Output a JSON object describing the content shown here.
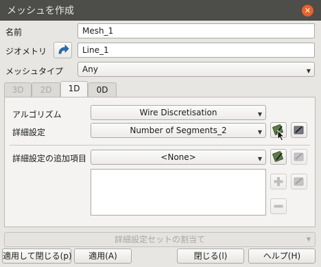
{
  "window": {
    "title": "メッシュを作成"
  },
  "form": {
    "name_label": "名前",
    "name_value": "Mesh_1",
    "geometry_label": "ジオメトリ",
    "geometry_value": "Line_1",
    "mesh_type_label": "メッシュタイプ",
    "mesh_type_value": "Any"
  },
  "tabs": [
    {
      "label": "3D",
      "state": "disabled"
    },
    {
      "label": "2D",
      "state": "disabled"
    },
    {
      "label": "1D",
      "state": "active"
    },
    {
      "label": "0D",
      "state": "normal"
    }
  ],
  "panel": {
    "algorithm_label": "アルゴリズム",
    "algorithm_value": "Wire Discretisation",
    "hypothesis_label": "詳細設定",
    "hypothesis_value": "Number of Segments_2",
    "additional_label": "詳細設定の追加項目",
    "additional_value": "<None>"
  },
  "assign_set_button": "詳細設定セットの割当て",
  "buttons": {
    "apply_close": "適用して閉じる(p)",
    "apply": "適用(A)",
    "close": "閉じる(l)",
    "help": "ヘルプ(H)"
  },
  "colors": {
    "titlebar": "#4d4d4a",
    "close": "#e8622a",
    "accent": "#2d6fb3"
  }
}
